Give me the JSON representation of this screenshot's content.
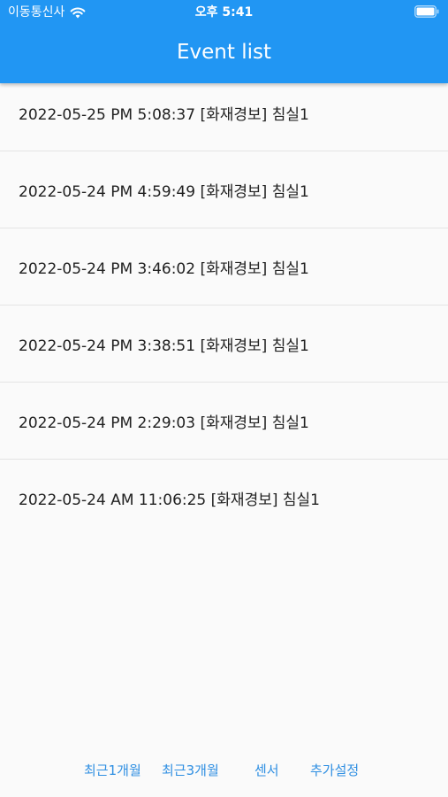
{
  "status_bar": {
    "carrier": "이동통신사",
    "time": "오후 5:41"
  },
  "header": {
    "title": "Event list"
  },
  "events": [
    "2022-05-25 PM 5:08:37 [화재경보] 침실1",
    "2022-05-24 PM 4:59:49 [화재경보] 침실1",
    "2022-05-24 PM 3:46:02 [화재경보] 침실1",
    "2022-05-24 PM 3:38:51 [화재경보] 침실1",
    "2022-05-24 PM 2:29:03 [화재경보] 침실1",
    "2022-05-24 AM 11:06:25 [화재경보] 침실1"
  ],
  "bottom_nav": {
    "recent_1_month": "최근1개월",
    "recent_3_months": "최근3개월",
    "sensor": "센서",
    "additional_settings": "추가설정"
  },
  "colors": {
    "app_bar": "#2196f3",
    "nav_text": "#2f8fe2"
  }
}
